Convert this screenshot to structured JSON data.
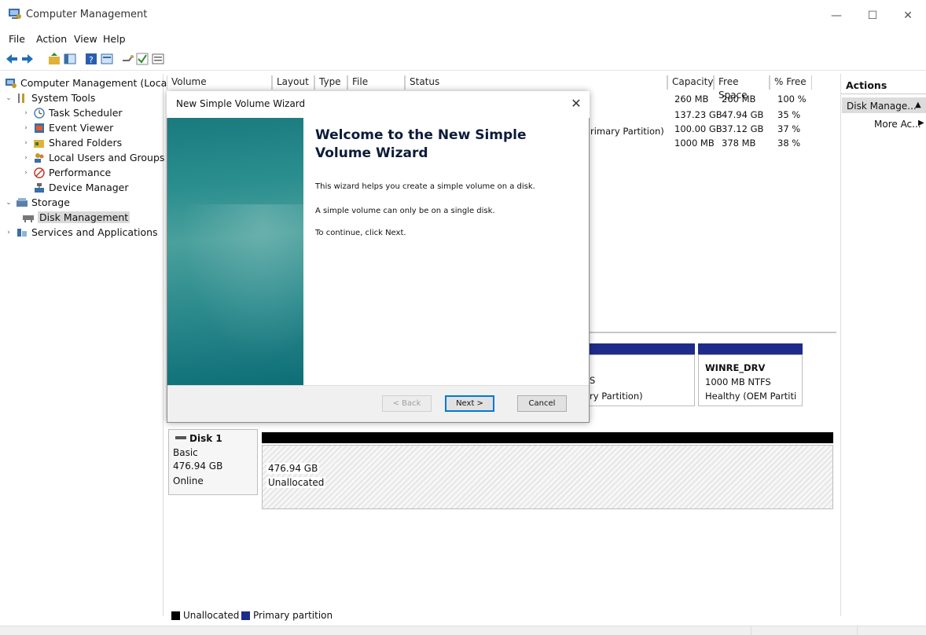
{
  "window": {
    "title": "Computer Management",
    "minimize": "—",
    "maximize": "☐",
    "close": "✕"
  },
  "menu": [
    "File",
    "Action",
    "View",
    "Help"
  ],
  "toolbar": {
    "icons": [
      "back-arrow-icon",
      "forward-arrow-icon",
      "up-folder-icon",
      "show-hide-tree-icon",
      "help-icon",
      "properties-icon",
      "connect-icon",
      "check-icon",
      "view-icon"
    ]
  },
  "tree": {
    "root": "Computer Management (Local)",
    "system_tools": "System Tools",
    "task_scheduler": "Task Scheduler",
    "event_viewer": "Event Viewer",
    "shared_folders": "Shared Folders",
    "local_users": "Local Users and Groups",
    "performance": "Performance",
    "device_manager": "Device Manager",
    "storage": "Storage",
    "disk_management": "Disk Management",
    "services": "Services and Applications"
  },
  "volume_list": {
    "headers": {
      "volume": "Volume",
      "layout": "Layout",
      "type": "Type",
      "file_system": "File System",
      "status": "Status",
      "capacity": "Capacity",
      "free_space": "Free Space",
      "pct_free": "% Free"
    },
    "rows": [
      {
        "status": "",
        "capacity": "260 MB",
        "free": "260 MB",
        "pct": "100 %"
      },
      {
        "status": "",
        "capacity": "137.23 GB",
        "free": "47.94 GB",
        "pct": "35 %"
      },
      {
        "status": "rimary Partition)",
        "capacity": "100.00 GB",
        "free": "37.12 GB",
        "pct": "37 %"
      },
      {
        "status": "",
        "capacity": "1000 MB",
        "free": "378 MB",
        "pct": "38 %"
      }
    ]
  },
  "actions": {
    "title": "Actions",
    "disk_management": "Disk Manage...",
    "more": "More Ac..."
  },
  "disk0_partitions": {
    "partial_fs": "S",
    "partial_status": "ry Partition)",
    "winre_name": "WINRE_DRV",
    "winre_size": "1000 MB NTFS",
    "winre_status": "Healthy (OEM Partiti"
  },
  "disk1": {
    "name": "Disk 1",
    "type": "Basic",
    "size": "476.94 GB",
    "state": "Online",
    "unalloc_size": "476.94 GB",
    "unalloc_label": "Unallocated"
  },
  "legend": {
    "unallocated": "Unallocated",
    "primary": "Primary partition",
    "unallocated_color": "#000000",
    "primary_color": "#1f2b8a"
  },
  "wizard": {
    "title": "New Simple Volume Wizard",
    "heading": "Welcome to the New Simple Volume Wizard",
    "line1": "This wizard helps you create a simple volume on a disk.",
    "line2": "A simple volume can only be on a single disk.",
    "line3": "To continue, click Next.",
    "back": "< Back",
    "next": "Next >",
    "cancel": "Cancel",
    "close": "✕"
  }
}
